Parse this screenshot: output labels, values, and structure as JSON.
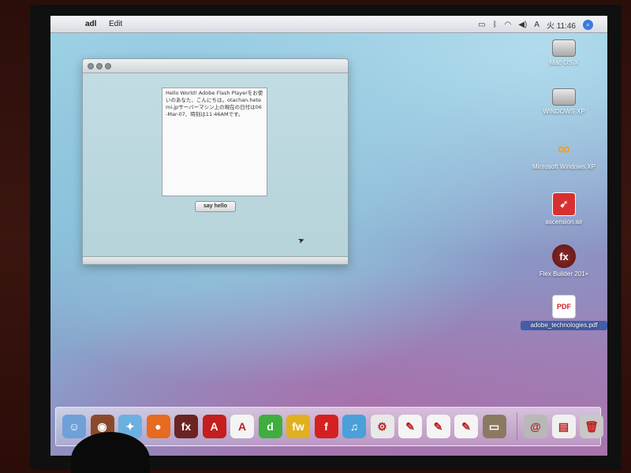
{
  "menubar": {
    "app_name": "adl",
    "menu_edit": "Edit",
    "clock": "火 11:46",
    "input_indicator": "A"
  },
  "window": {
    "text_content": "Hello World! Adobe Flash Playerをお使いのあなた、こんにちは。otachan.hetemi.jpサーバーマシン上の現在の日付は06-Mar-07、時刻は11:46AMです。",
    "button_label": "say hello"
  },
  "desktop_icons": [
    {
      "label": "Mac OS X",
      "icon": "hard-disk-icon"
    },
    {
      "label": "WINDOWS XP",
      "icon": "hard-disk-icon"
    },
    {
      "label": "Microsoft Windows XP",
      "icon": "parallels-vm-icon"
    },
    {
      "label": "ascension.air",
      "icon": "air-package-icon"
    },
    {
      "label": "Flex Builder 201+",
      "icon": "flex-builder-icon"
    },
    {
      "label": "adobe_technologies.pdf",
      "icon": "pdf-icon"
    }
  ],
  "dock": {
    "items": [
      {
        "name": "finder",
        "glyph": "☺",
        "color": "#6fa0d8"
      },
      {
        "name": "dashboard",
        "glyph": "◉",
        "color": "#8a4a2a"
      },
      {
        "name": "safari",
        "glyph": "✦",
        "color": "#6ab0e0"
      },
      {
        "name": "firefox",
        "glyph": "●",
        "color": "#e66a1f"
      },
      {
        "name": "flex-builder",
        "glyph": "fx",
        "color": "#6b2323"
      },
      {
        "name": "acrobat",
        "glyph": "A",
        "color": "#c41e1e"
      },
      {
        "name": "acrobat-reader",
        "glyph": "A",
        "color": "#f4f4f4"
      },
      {
        "name": "dreamweaver",
        "glyph": "d",
        "color": "#3fae3f"
      },
      {
        "name": "fireworks",
        "glyph": "fw",
        "color": "#e0b020"
      },
      {
        "name": "flash",
        "glyph": "f",
        "color": "#d42020"
      },
      {
        "name": "itunes",
        "glyph": "♫",
        "color": "#4aa0d8"
      },
      {
        "name": "system-preferences",
        "glyph": "⚙",
        "color": "#e8e8e8"
      },
      {
        "name": "document-1",
        "glyph": "✎",
        "color": "#f4f4f4"
      },
      {
        "name": "document-2",
        "glyph": "✎",
        "color": "#f4f4f4"
      },
      {
        "name": "document-3",
        "glyph": "✎",
        "color": "#f4f4f4"
      },
      {
        "name": "minimized-window",
        "glyph": "▭",
        "color": "#8a7a60"
      }
    ],
    "right_items": [
      {
        "name": "mail-stack",
        "glyph": "@",
        "color": "#b8b8b8"
      },
      {
        "name": "downloads-stack",
        "glyph": "▤",
        "color": "#f0f0f0"
      },
      {
        "name": "trash",
        "glyph": "🗑",
        "color": "#c8c8c8"
      }
    ]
  }
}
